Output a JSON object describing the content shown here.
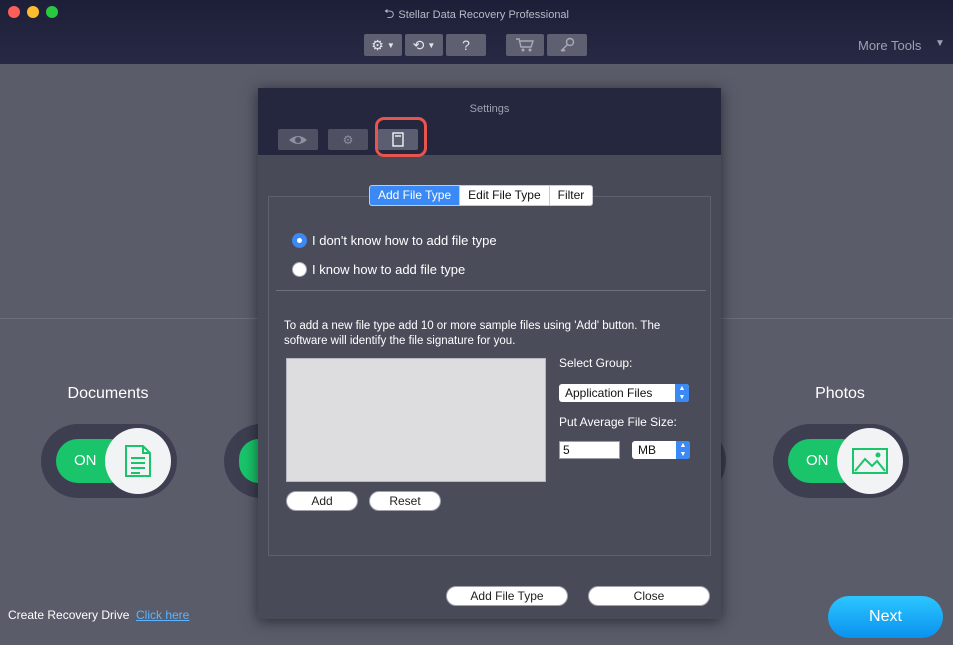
{
  "window": {
    "title": "Stellar Data Recovery Professional"
  },
  "toolbar": {
    "help_label": "?",
    "more_tools_label": "More Tools",
    "more_tools_caret": "▼"
  },
  "categories": [
    {
      "label": "Documents",
      "toggle_label": "ON",
      "icon": "document-icon"
    },
    {
      "label": "Photos",
      "toggle_label": "ON",
      "icon": "photo-icon"
    }
  ],
  "footer": {
    "recovery_label": "Create Recovery Drive",
    "recovery_link": "Click here",
    "next_label": "Next"
  },
  "dialog": {
    "title": "Settings",
    "tabs": [
      {
        "icon": "eye-icon"
      },
      {
        "icon": "gear-icon"
      },
      {
        "icon": "file-type-icon",
        "active": true
      }
    ],
    "segments": [
      "Add File Type",
      "Edit File Type",
      "Filter"
    ],
    "selected_segment": "Add File Type",
    "radio_options": [
      {
        "label": "I don't know how to add file type",
        "selected": true
      },
      {
        "label": "I know how to add file type",
        "selected": false
      }
    ],
    "instructions": "To add a new file type add 10 or more sample files using 'Add' button. The software will identify the file signature for you.",
    "add_label": "Add",
    "reset_label": "Reset",
    "select_group_label": "Select Group:",
    "select_group_value": "Application Files",
    "file_size_label": "Put Average File Size:",
    "file_size_value": "5",
    "file_size_unit": "MB",
    "add_file_type_label": "Add File Type",
    "close_label": "Close"
  },
  "colors": {
    "accent": "#3b89f5",
    "toggle_on": "#19c46a",
    "highlight": "#e9544e",
    "next": "#1aaaf8"
  }
}
